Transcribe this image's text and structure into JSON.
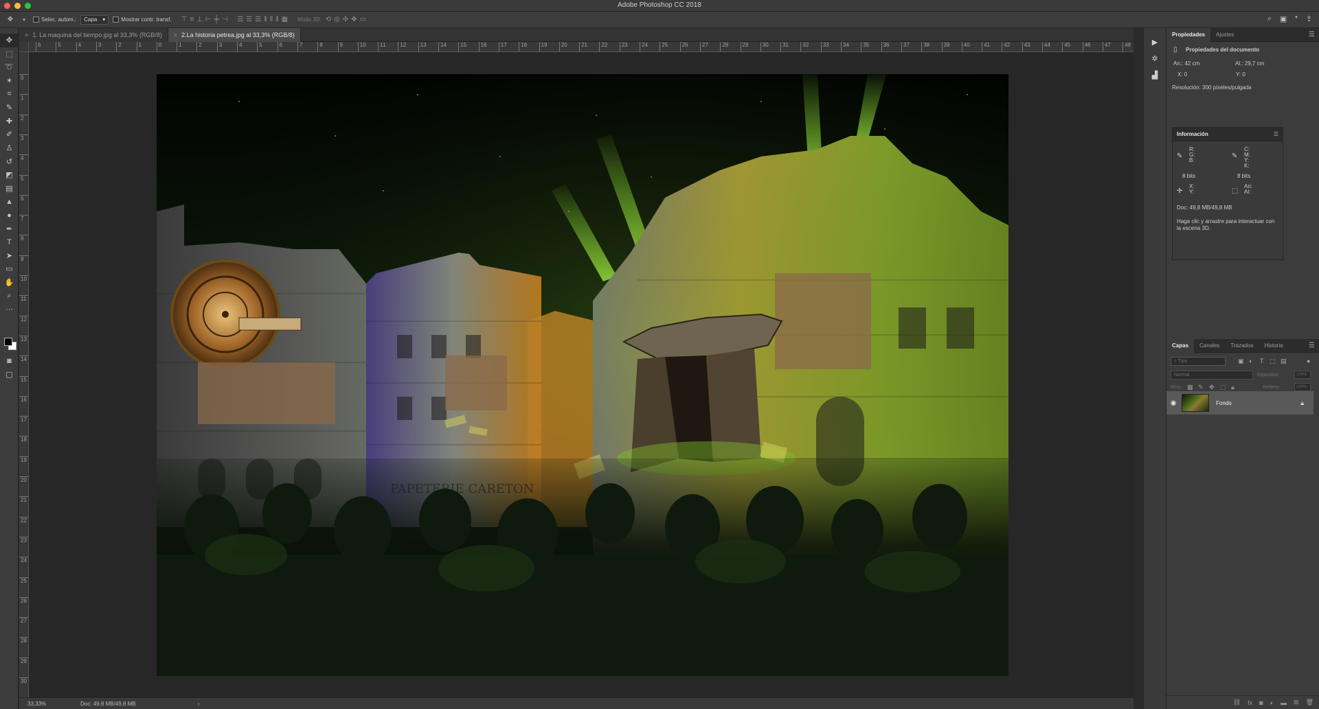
{
  "app": {
    "title": "Adobe Photoshop CC 2018",
    "traffic_lights": [
      "#ff5f57",
      "#febc2e",
      "#28c840"
    ]
  },
  "options_bar": {
    "auto_select_label": "Selec. autom.:",
    "auto_select_target": "Capa",
    "show_transform_label": "Mostrar contr. transf.",
    "mode_3d_label": "Modo 3D:"
  },
  "tabs": [
    {
      "label": "1. La maquina del tiempo.jpg al 33,3% (RGB/8)",
      "close": "×"
    },
    {
      "label": "2.La historia petrea.jpg al 33,3% (RGB/8)",
      "close": "×"
    }
  ],
  "ruler": {
    "h": [
      "6",
      "5",
      "4",
      "3",
      "2",
      "1",
      "0",
      "1",
      "2",
      "3",
      "4",
      "5",
      "6",
      "7",
      "8",
      "9",
      "10",
      "11",
      "12",
      "13",
      "14",
      "15",
      "16",
      "17",
      "18",
      "19",
      "20",
      "21",
      "22",
      "23",
      "24",
      "25",
      "26",
      "27",
      "28",
      "29",
      "30",
      "31",
      "32",
      "33",
      "34",
      "35",
      "36",
      "37",
      "38",
      "39",
      "40",
      "41",
      "42",
      "43",
      "44",
      "45",
      "46",
      "47",
      "48"
    ],
    "v": [
      "0",
      "1",
      "2",
      "3",
      "4",
      "5",
      "6",
      "7",
      "8",
      "9",
      "10",
      "11",
      "12",
      "13",
      "14",
      "15",
      "16",
      "17",
      "18",
      "19",
      "20",
      "21",
      "22",
      "23",
      "24",
      "25",
      "26",
      "27",
      "28",
      "29",
      "30"
    ]
  },
  "status": {
    "zoom": "33,33%",
    "doc": "Doc: 49,8 MB/49,8 MB",
    "arrow": "›"
  },
  "properties": {
    "tabs": [
      "Propiedades",
      "Ajustes"
    ],
    "header": "Propiedades del documento",
    "width": "An.: 42 cm",
    "height": "Al.: 29,7 cm",
    "x": "X: 0",
    "y": "Y: 0",
    "resolution": "Resolución: 300 píxeles/pulgada"
  },
  "info": {
    "title": "Información",
    "rgb": "R:\nG:\nB:",
    "cmyk": "C:\nM:\nY:\nK:",
    "bits_left": "8 bits",
    "bits_right": "8 bits",
    "xy": "X:\nY:",
    "wh": "An:\nAl:",
    "doc": "Doc: 49,8 MB/49,8 MB",
    "hint": "Haga clic y arrastre para interactuar con la escena 3D."
  },
  "layers": {
    "tabs": [
      "Capas",
      "Canales",
      "Trazados",
      "Historia"
    ],
    "search_placeholder": "Tipo",
    "blend_mode": "Normal",
    "opacity_label": "Opacidad:",
    "opacity_value": "100%",
    "lock_label": "Bloq.:",
    "fill_label": "Relleno:",
    "fill_value": "100%",
    "layer_name": "Fondo"
  }
}
